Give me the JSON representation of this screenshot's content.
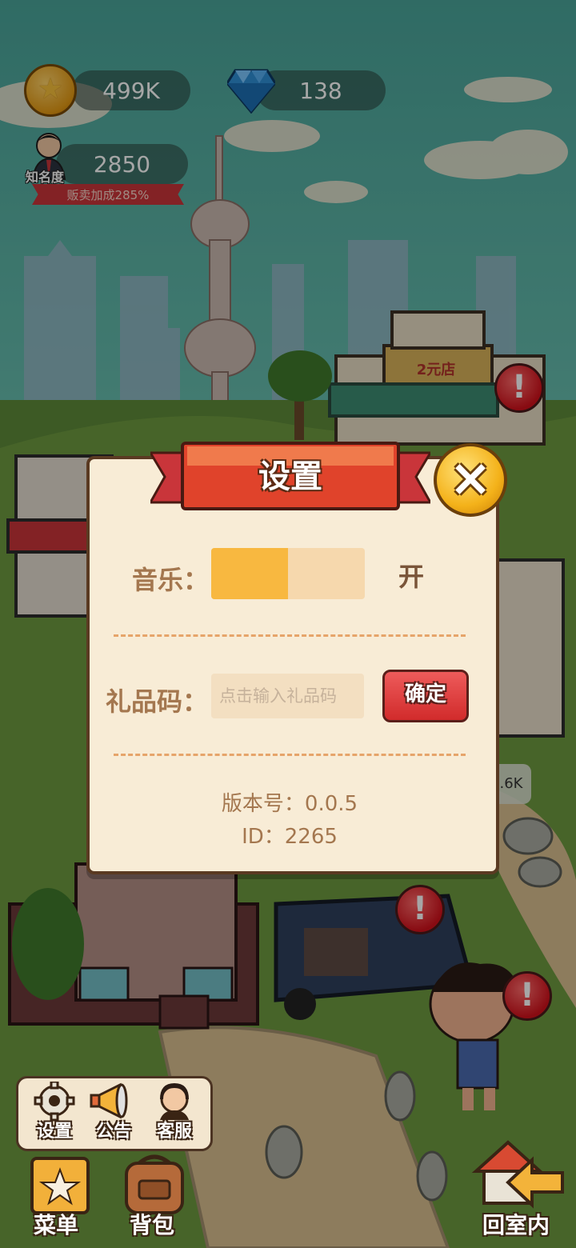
{
  "hud": {
    "coins": "499K",
    "gems": "138",
    "fame_label": "知名度",
    "fame_value": "2850",
    "sale_bonus": "贩卖加成285%"
  },
  "scene": {
    "shop_sign": "2元店",
    "side_tag": ".6K",
    "alert_mark": "!"
  },
  "settings_dialog": {
    "title": "设置",
    "close_icon": "×",
    "music_label": "音乐：",
    "music_state": "开",
    "music_level": 0.5,
    "gift_code_label": "礼品码：",
    "gift_code_placeholder": "点击输入礼品码",
    "confirm_label": "确定",
    "version": "版本号：0.0.5",
    "id": "ID：2265"
  },
  "submenu": [
    {
      "label": "设置",
      "icon": "gear-icon"
    },
    {
      "label": "公告",
      "icon": "megaphone-icon"
    },
    {
      "label": "客服",
      "icon": "support-agent-icon"
    }
  ],
  "bottom_bar": {
    "menu_label": "菜单",
    "bag_label": "背包",
    "home_label": "回室内"
  },
  "colors": {
    "dialog_bg": "#f8ecd6",
    "ribbon_red": "#e0432b",
    "toggle_on": "#f8b840",
    "confirm_red": "#d12b2b"
  }
}
